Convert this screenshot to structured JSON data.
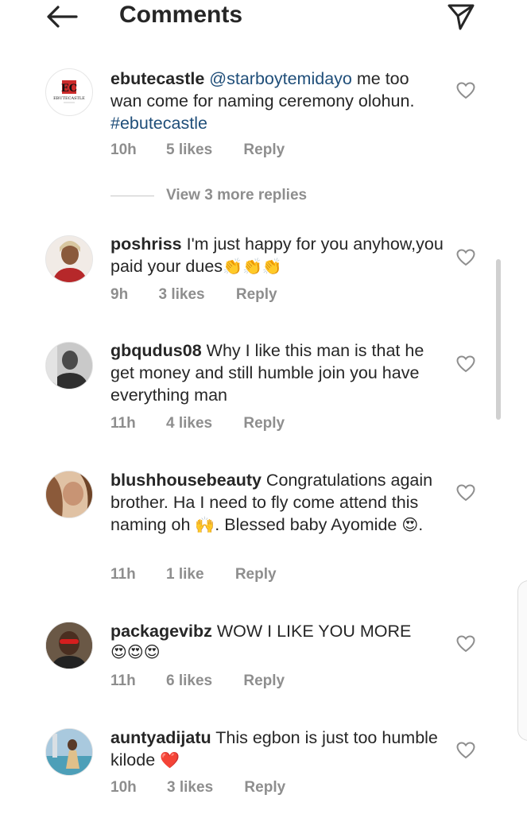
{
  "header": {
    "title": "Comments"
  },
  "comments": [
    {
      "username": "ebutecastle",
      "mention": "@starboytemidayo",
      "text_before_hashtag": " me too wan come for naming ceremony olohun. ",
      "hashtag": "#ebutecastle",
      "time": "10h",
      "likes": "5 likes",
      "reply": "Reply",
      "avatar_text": "EBUTECASTLE"
    },
    {
      "username": "poshriss",
      "text": " I'm just happy for you anyhow,you paid your dues",
      "emoji": "👏👏👏",
      "time": "9h",
      "likes": "3 likes",
      "reply": "Reply"
    },
    {
      "username": "gbqudus08",
      "text": " Why I like this man is that he get money and still humble join you have everything man",
      "time": "11h",
      "likes": "4 likes",
      "reply": "Reply"
    },
    {
      "username": "blushhousebeauty",
      "text_a": " Congratulations again brother. Ha I need to fly come attend this naming oh ",
      "emoji_a": "🙌",
      "text_b": ". Blessed baby Ayomide ",
      "emoji_b": "😍",
      "text_c": ".",
      "time": "11h",
      "likes": "1 like",
      "reply": "Reply"
    },
    {
      "username": "packagevibz",
      "text": " WOW I LIKE YOU MORE",
      "emoji": "😍😍😍",
      "time": "11h",
      "likes": "6 likes",
      "reply": "Reply"
    },
    {
      "username": "auntyadijatu",
      "text": " This egbon is just too humble kilode ",
      "emoji": "❤️",
      "time": "10h",
      "likes": "3 likes",
      "reply": "Reply"
    }
  ],
  "view_replies": "View 3 more replies",
  "colors": {
    "link": "#1f4e79",
    "meta": "#8e8e8e",
    "text": "#262626"
  }
}
